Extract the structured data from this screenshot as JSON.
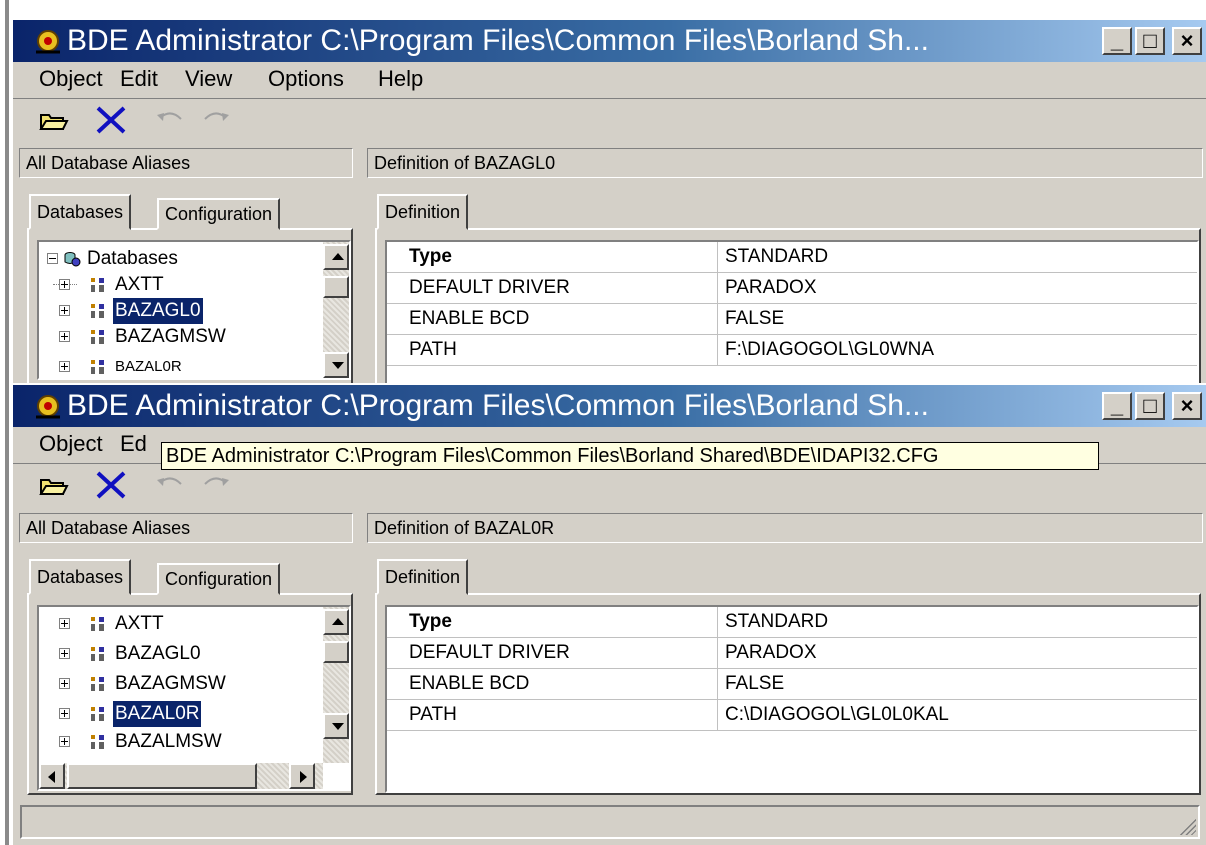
{
  "app": {
    "title_icon": "bde-gear-icon"
  },
  "windows": [
    {
      "title": "BDE Administrator  C:\\Program Files\\Common Files\\Borland Sh...",
      "menu": [
        "Object",
        "Edit",
        "View",
        "Options",
        "Help"
      ],
      "left_header": "All Database Aliases",
      "right_header": "Definition of BAZAGL0",
      "tabs": [
        "Databases",
        "Configuration"
      ],
      "def_tab": "Definition",
      "tree": [
        {
          "label": "Databases",
          "root": true
        },
        {
          "label": "AXTT"
        },
        {
          "label": "BAZAGL0",
          "selected": true
        },
        {
          "label": "BAZAGMSW"
        },
        {
          "label": "BAZAL0R"
        }
      ],
      "definition": [
        {
          "key": "Type",
          "value": "STANDARD"
        },
        {
          "key": "DEFAULT DRIVER",
          "value": "PARADOX"
        },
        {
          "key": "ENABLE BCD",
          "value": "FALSE"
        },
        {
          "key": "PATH",
          "value": "F:\\DIAGOGOL\\GL0WNA"
        }
      ]
    },
    {
      "title": "BDE Administrator  C:\\Program Files\\Common Files\\Borland Sh...",
      "menu": [
        "Object",
        "Ed"
      ],
      "left_header": "All Database Aliases",
      "right_header": "Definition of BAZAL0R",
      "tabs": [
        "Databases",
        "Configuration"
      ],
      "def_tab": "Definition",
      "tree": [
        {
          "label": "AXTT"
        },
        {
          "label": "BAZAGL0"
        },
        {
          "label": "BAZAGMSW"
        },
        {
          "label": "BAZAL0R",
          "selected": true
        },
        {
          "label": "BAZALMSW"
        }
      ],
      "definition": [
        {
          "key": "Type",
          "value": "STANDARD"
        },
        {
          "key": "DEFAULT DRIVER",
          "value": "PARADOX"
        },
        {
          "key": "ENABLE BCD",
          "value": "FALSE"
        },
        {
          "key": "PATH",
          "value": "C:\\DIAGOGOL\\GL0L0KAL"
        }
      ]
    }
  ],
  "tooltip": "BDE Administrator  C:\\Program Files\\Common Files\\Borland Shared\\BDE\\IDAPI32.CFG",
  "colors": {
    "title_start": "#0a246a",
    "title_end": "#a6caf0",
    "face": "#d4d0c8",
    "selection": "#0a246a",
    "tooltip_bg": "#ffffe1",
    "delete_x": "#1010c0"
  }
}
